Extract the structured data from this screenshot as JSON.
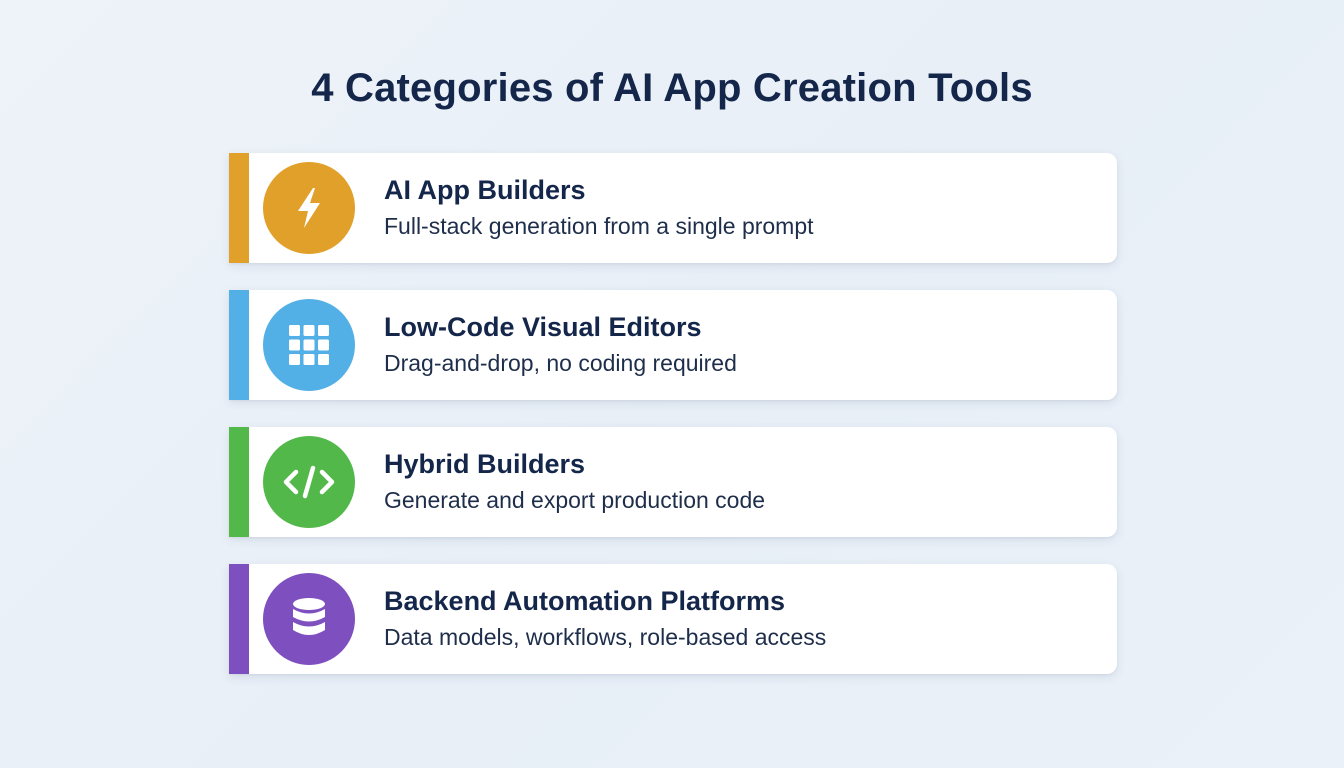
{
  "title": "4 Categories of AI App Creation Tools",
  "categories": [
    {
      "title": "AI App Builders",
      "description": "Full-stack generation from a single prompt",
      "icon": "lightning-bolt-icon",
      "color": "#e0a02a"
    },
    {
      "title": "Low-Code Visual Editors",
      "description": "Drag-and-drop, no coding required",
      "icon": "grid-icon",
      "color": "#53b0e6"
    },
    {
      "title": "Hybrid Builders",
      "description": "Generate and export production code",
      "icon": "code-icon",
      "color": "#52b84a"
    },
    {
      "title": "Backend Automation Platforms",
      "description": "Data models, workflows, role-based access",
      "icon": "database-icon",
      "color": "#7e4fbf"
    }
  ]
}
